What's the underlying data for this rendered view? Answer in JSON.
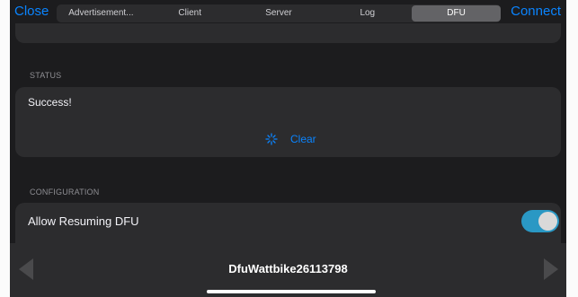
{
  "nav": {
    "close_label": "Close",
    "connect_label": "Connect",
    "tabs": [
      {
        "label": "Advertisement..."
      },
      {
        "label": "Client"
      },
      {
        "label": "Server"
      },
      {
        "label": "Log"
      },
      {
        "label": "DFU",
        "active": true
      }
    ]
  },
  "status": {
    "header": "STATUS",
    "text": "Success!",
    "clear_label": "Clear"
  },
  "configuration": {
    "header": "CONFIGURATION",
    "allow_resuming_label": "Allow Resuming DFU",
    "allow_resuming_enabled": true
  },
  "bottom": {
    "device_name": "DfuWattbike26113798"
  },
  "colors": {
    "accent": "#0a84ff",
    "toggle_on": "#2a98c4",
    "background": "#1c1c1e",
    "card": "#2c2c2e"
  },
  "icons": {
    "clear": "sparkle-clear-icon",
    "prev": "chevron-left-icon",
    "next": "chevron-right-icon"
  }
}
